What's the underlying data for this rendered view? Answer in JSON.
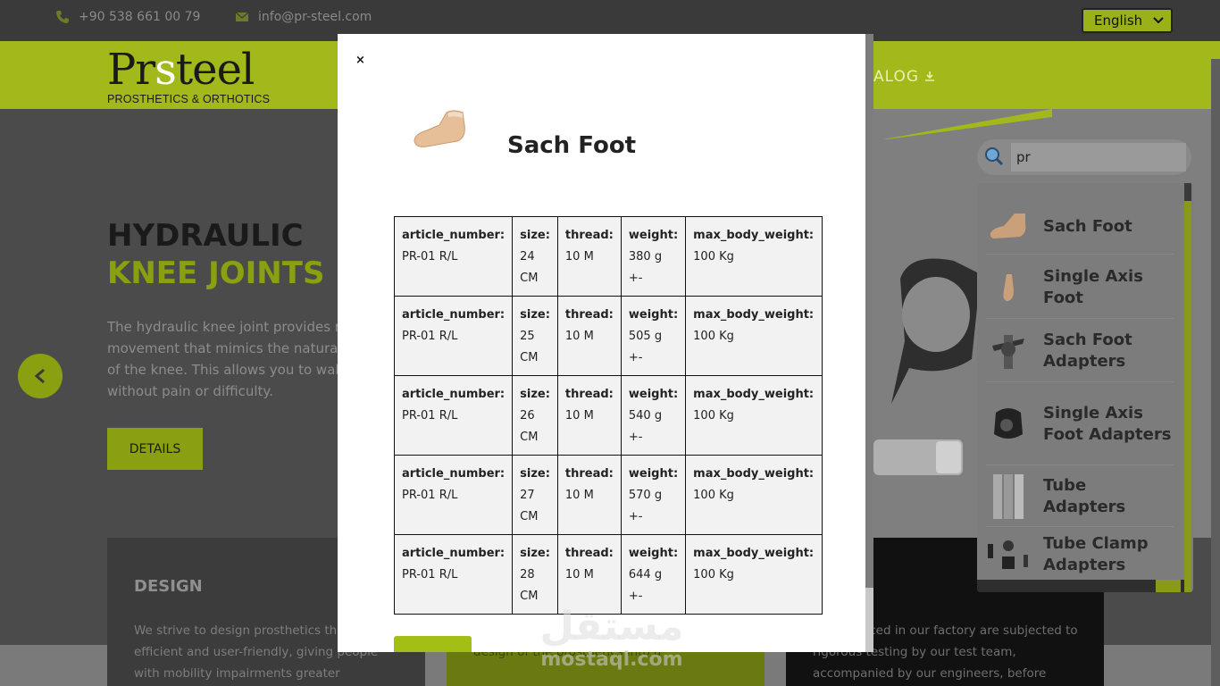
{
  "topbar": {
    "phone": "+90 538 661 00 79",
    "email": "info@pr-steel.com",
    "language": "English"
  },
  "header": {
    "brand_pr": "Pr",
    "brand_s": "s",
    "brand_teel": "teel",
    "tagline": "PROSTHETICS & ORTHOTICS",
    "catalog_label": "ALOG"
  },
  "hero": {
    "title_line1": "HYDRAULIC",
    "title_line2": "KNEE JOINTS",
    "text_lines": [
      "The hydraulic knee joint provides n",
      "movement that mimics the natural",
      "of the knee. This allows you to walk",
      "without pain or difficulty."
    ],
    "details_label": "DETAILS"
  },
  "cards": [
    {
      "title": "DESIGN",
      "text": "We strive to design prosthetics that are efficient and user-friendly, giving people with mobility impairments greater independence"
    },
    {
      "title": "",
      "text": "technical team transforms the meticulous design of the prosthetics into a"
    },
    {
      "title": "",
      "text": "cts produced in our factory are subjected to rigorous testing by our test team, accompanied by our engineers, before"
    }
  ],
  "search": {
    "value": "pr",
    "results": [
      {
        "label": "Sach Foot",
        "icon": "foot-icon"
      },
      {
        "label": "Single Axis Foot",
        "icon": "foot-small-icon"
      },
      {
        "label": "Sach Foot Adapters",
        "icon": "adapter-icon"
      },
      {
        "label": "Single Axis Foot Adapters",
        "icon": "axis-adapter-icon"
      },
      {
        "label": "Tube Adapters",
        "icon": "tube-icon"
      },
      {
        "label": "Tube Clamp Adapters",
        "icon": "clamp-icon"
      }
    ]
  },
  "modal": {
    "close_label": "×",
    "title": "Sach Foot",
    "columns": [
      "article_number:",
      "size:",
      "thread:",
      "weight:",
      "max_body_weight:"
    ],
    "rows": [
      [
        "PR-01 R/L",
        "24 CM",
        "10 M",
        "380 g +-",
        "100 Kg"
      ],
      [
        "PR-01 R/L",
        "25 CM",
        "10 M",
        "505 g +-",
        "100 Kg"
      ],
      [
        "PR-01 R/L",
        "26 CM",
        "10 M",
        "540 g +-",
        "100 Kg"
      ],
      [
        "PR-01 R/L",
        "27 CM",
        "10 M",
        "570 g +-",
        "100 Kg"
      ],
      [
        "PR-01 R/L",
        "28 CM",
        "10 M",
        "644 g +-",
        "100 Kg"
      ]
    ]
  },
  "watermark": {
    "arabic": "مستقل",
    "latin": "mostaql.com"
  },
  "colors": {
    "accent": "#a3b81a",
    "dark": "#3a3a3a"
  }
}
